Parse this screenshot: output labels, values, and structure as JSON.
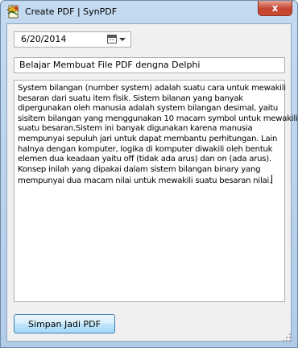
{
  "window": {
    "title": "Create PDF | SynPDF",
    "close_glyph": "x"
  },
  "form": {
    "date_value": "6/20/2014",
    "title_value": "Belajar Membuat File PDF dengna Delphi",
    "content_lines": [
      "System bilangan (number system) adalah  suatu cara untuk mewakili",
      "besaran dari suatu item fisik. Sistem bilanan yang banyak",
      "dipergunakan oleh manusia adalah system bilangan desimal, yaitu",
      "sisitem bilangan yang menggunakan 10 macam symbol untuk mewakili",
      "suatu besaran.Sistem ini banyak digunakan karena manusia",
      "mempunyai sepuluh jari untuk dapat membantu perhitungan. Lain",
      "halnya dengan komputer, logika di komputer diwakili oleh bentuk",
      "elemen dua keadaan yaitu off (tidak ada arus) dan on (ada arus).",
      "Konsep inilah yang dipakai dalam sistem bilangan binary yang",
      "mempunyai dua macam nilai  untuk mewakili suatu besaran nilai."
    ],
    "save_label": "Simpan Jadi PDF"
  },
  "icons": {
    "app": "pdf-app-icon",
    "calendar": "calendar-icon",
    "dropdown": "chevron-down-icon",
    "close": "close-icon"
  },
  "colors": {
    "frame": "#c4daf1",
    "close_button": "#c4422f",
    "client_background": "#f0f0f0",
    "button_border": "#3c7fb1"
  }
}
